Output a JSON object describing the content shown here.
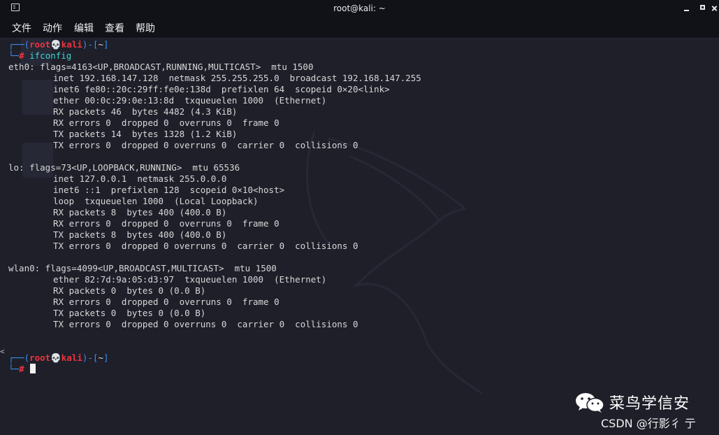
{
  "window": {
    "title": "root@kali: ~"
  },
  "menu": [
    "文件",
    "动作",
    "编辑",
    "查看",
    "帮助"
  ],
  "prompt": {
    "frame_top": "┌──(",
    "user": "root",
    "skull": "💀",
    "host": "kali",
    "dir_open": ")-[",
    "dir": "~",
    "dir_close": "]",
    "frame_bottom": "└─",
    "symbol": "#"
  },
  "command": "ifconfig",
  "output": {
    "eth0": {
      "header": "eth0: flags=4163<UP,BROADCAST,RUNNING,MULTICAST>  mtu 1500",
      "lines": [
        "inet 192.168.147.128  netmask 255.255.255.0  broadcast 192.168.147.255",
        "inet6 fe80::20c:29ff:fe0e:138d  prefixlen 64  scopeid 0×20<link>",
        "ether 00:0c:29:0e:13:8d  txqueuelen 1000  (Ethernet)",
        "RX packets 46  bytes 4482 (4.3 KiB)",
        "RX errors 0  dropped 0  overruns 0  frame 0",
        "TX packets 14  bytes 1328 (1.2 KiB)",
        "TX errors 0  dropped 0 overruns 0  carrier 0  collisions 0"
      ]
    },
    "lo": {
      "header": "lo: flags=73<UP,LOOPBACK,RUNNING>  mtu 65536",
      "lines": [
        "inet 127.0.0.1  netmask 255.0.0.0",
        "inet6 ::1  prefixlen 128  scopeid 0×10<host>",
        "loop  txqueuelen 1000  (Local Loopback)",
        "RX packets 8  bytes 400 (400.0 B)",
        "RX errors 0  dropped 0  overruns 0  frame 0",
        "TX packets 8  bytes 400 (400.0 B)",
        "TX errors 0  dropped 0 overruns 0  carrier 0  collisions 0"
      ]
    },
    "wlan0": {
      "header": "wlan0: flags=4099<UP,BROADCAST,MULTICAST>  mtu 1500",
      "lines": [
        "ether 82:7d:9a:05:d3:97  txqueuelen 1000  (Ethernet)",
        "RX packets 0  bytes 0 (0.0 B)",
        "RX errors 0  dropped 0  overruns 0  frame 0",
        "TX packets 0  bytes 0 (0.0 B)",
        "TX errors 0  dropped 0 overruns 0  carrier 0  collisions 0"
      ]
    }
  },
  "watermark": {
    "title": "菜鸟学信安",
    "subtitle": "CSDN @行影彳 亍"
  },
  "colors": {
    "background": "#1e1f29",
    "titlebar": "#111218",
    "prompt_frame": "#3d8ff2",
    "prompt_user": "#ef3340",
    "command": "#3dd5d0",
    "text": "#d8d8d8"
  },
  "icons": [
    "terminal-icon",
    "minimize-icon",
    "maximize-icon",
    "close-icon",
    "skull-icon",
    "wechat-icon",
    "kali-dragon-watermark"
  ]
}
